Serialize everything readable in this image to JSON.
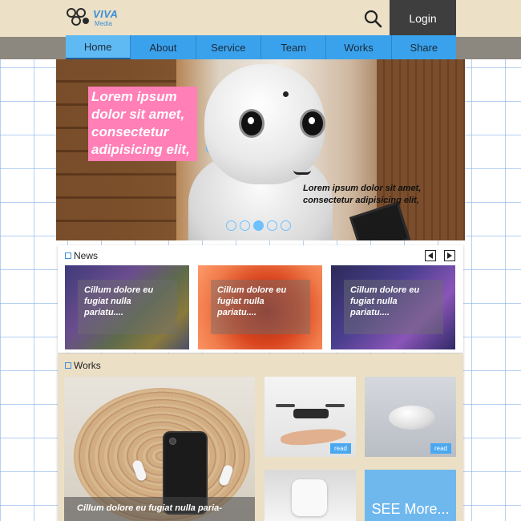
{
  "brand": {
    "name": "VIVA",
    "tagline": "Media",
    "accent": "#3a8fd8"
  },
  "header": {
    "login_label": "Login",
    "search_icon": "search-icon"
  },
  "nav": {
    "active_color": "#3aa2ec",
    "items": [
      {
        "label": "Home",
        "active": true
      },
      {
        "label": "About"
      },
      {
        "label": "Service"
      },
      {
        "label": "Team"
      },
      {
        "label": "Works"
      },
      {
        "label": "Share"
      }
    ]
  },
  "hero": {
    "headline": "Lorem ipsum dolor sit amet, consectetur adipisicing elit,",
    "caption": "Lorem ipsum dolor sit amet, consectetur adipisicing elit,",
    "headline_bg": "#ff7fb6",
    "slides_total": 5,
    "active_slide": 3
  },
  "news": {
    "title": "News",
    "prev_icon": "arrow-left-icon",
    "next_icon": "arrow-right-icon",
    "cards": [
      {
        "text": "Cillum dolore eu fugiat nulla pariatu...."
      },
      {
        "text": "Cillum dolore eu fugiat nulla pariatu...."
      },
      {
        "text": "Cillum dolore eu fugiat nulla pariatu...."
      }
    ]
  },
  "works": {
    "title": "Works",
    "feature_caption": "Cillum dolore eu fugiat nulla paria-",
    "read_label": "read",
    "see_more_label": "SEE More..."
  }
}
